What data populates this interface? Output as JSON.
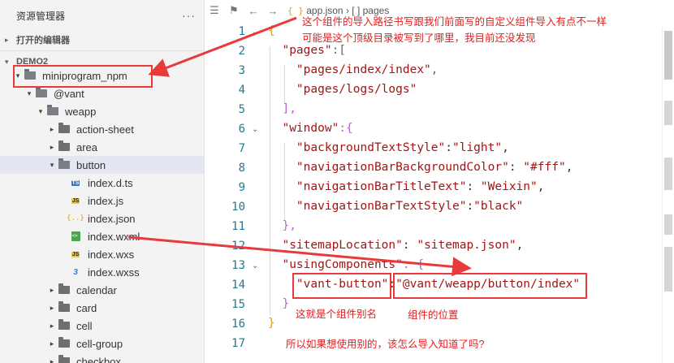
{
  "sidebar": {
    "title": "资源管理器",
    "more": "···",
    "open_editors": "打开的编辑器",
    "workspace": "DEMO2",
    "items": [
      {
        "label": "miniprogram_npm",
        "indent": 0,
        "type": "folder-open",
        "arrow": "▾",
        "highlight": true
      },
      {
        "label": "@vant",
        "indent": 1,
        "type": "folder-open",
        "arrow": "▾"
      },
      {
        "label": "weapp",
        "indent": 2,
        "type": "folder-open",
        "arrow": "▾"
      },
      {
        "label": "action-sheet",
        "indent": 3,
        "type": "folder",
        "arrow": "▸"
      },
      {
        "label": "area",
        "indent": 3,
        "type": "folder",
        "arrow": "▸"
      },
      {
        "label": "button",
        "indent": 3,
        "type": "folder-open",
        "arrow": "▾",
        "selected": true
      },
      {
        "label": "index.d.ts",
        "indent": 4,
        "type": "ts"
      },
      {
        "label": "index.js",
        "indent": 4,
        "type": "js"
      },
      {
        "label": "index.json",
        "indent": 4,
        "type": "json"
      },
      {
        "label": "index.wxml",
        "indent": 4,
        "type": "wxml"
      },
      {
        "label": "index.wxs",
        "indent": 4,
        "type": "js"
      },
      {
        "label": "index.wxss",
        "indent": 4,
        "type": "wxss"
      },
      {
        "label": "calendar",
        "indent": 3,
        "type": "folder",
        "arrow": "▸"
      },
      {
        "label": "card",
        "indent": 3,
        "type": "folder",
        "arrow": "▸"
      },
      {
        "label": "cell",
        "indent": 3,
        "type": "folder",
        "arrow": "▸"
      },
      {
        "label": "cell-group",
        "indent": 3,
        "type": "folder",
        "arrow": "▸"
      },
      {
        "label": "checkbox",
        "indent": 3,
        "type": "folder",
        "arrow": "▸"
      }
    ]
  },
  "editor": {
    "breadcrumb_icon": "{ }",
    "breadcrumb_file": "app.json",
    "breadcrumb_sep": "›",
    "breadcrumb_node": "[ ] pages",
    "icons": [
      "list-icon",
      "bookmark-icon",
      "back-arrow-icon",
      "forward-arrow-icon"
    ]
  },
  "code": {
    "line_numbers": [
      "1",
      "2",
      "3",
      "4",
      "5",
      "6",
      "7",
      "8",
      "9",
      "10",
      "11",
      "12",
      "13",
      "14",
      "15",
      "16",
      "17"
    ],
    "l1": "{",
    "l2_key": "\"pages\"",
    "l2_rest": ":[",
    "l3": "\"pages/index/index\"",
    "l3_comma": ",",
    "l4": "\"pages/logs/logs\"",
    "l5": "],",
    "l6_key": "\"window\"",
    "l6_rest": ":{",
    "l7_key": "\"backgroundTextStyle\"",
    "l7_val": "\"light\"",
    "l8_key": "\"navigationBarBackgroundColor\"",
    "l8_val": "\"#fff\"",
    "l9_key": "\"navigationBarTitleText\"",
    "l9_val": "\"Weixin\"",
    "l10_key": "\"navigationBarTextStyle\"",
    "l10_val": "\"black\"",
    "l11": "},",
    "l12_key": "\"sitemapLocation\"",
    "l12_val": "\"sitemap.json\"",
    "l13_key": "\"usingComponents\"",
    "l13_rest": ": {",
    "l14_key": "\"vant-button\"",
    "l14_val": "\"@vant/weapp/button/index\"",
    "l15": "}",
    "l16": "}"
  },
  "annotations": {
    "note1_line1": "这个组件的导入路径书写跟我们前面写的自定义组件导入有点不一样",
    "note1_line2": "可能是这个顶级目录被写到了哪里，我目前还没发现",
    "note_alias": "这就是个组件别名",
    "note_location": "组件的位置",
    "note_question": "所以如果想使用别的，该怎么导入知道了吗?"
  },
  "colors": {
    "annotation_red": "#e83a3a",
    "selected_row": "#e4e6f1",
    "line_number": "#237893"
  }
}
